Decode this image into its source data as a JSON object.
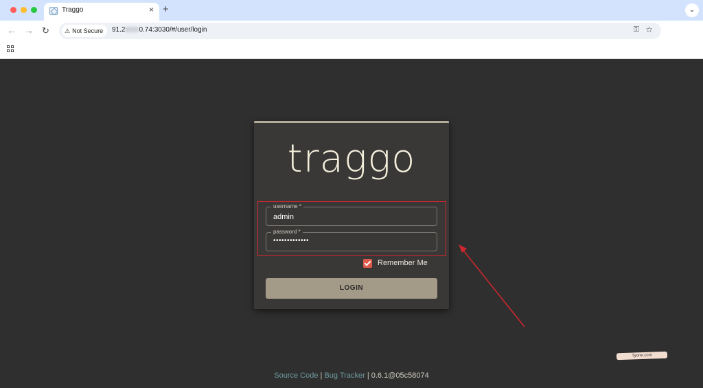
{
  "browser": {
    "tab_title": "Traggo",
    "tab_close": "×",
    "new_tab": "+",
    "security_label": "Not Secure",
    "url_prefix": "91.2",
    "url_suffix": "0.74:3030/#/user/login"
  },
  "login": {
    "logo": "traggo",
    "username_label": "username *",
    "username_value": "admin",
    "password_label": "password *",
    "password_value": "•••••••••••••",
    "remember_label": "Remember Me",
    "remember_checked": true,
    "login_button": "LOGIN"
  },
  "footer": {
    "source_code": "Source Code",
    "separator": "|",
    "bug_tracker": "Bug Tracker",
    "version": "| 0.6.1@05c58074"
  },
  "watermark": "Tyone.com",
  "colors": {
    "page_bg": "#2f2f2f",
    "card_bg": "#3a3836",
    "button_bg": "#a49a88",
    "checkbox": "#e05a4c",
    "annotation_red": "#d0262e",
    "link": "#6e9aa0"
  }
}
